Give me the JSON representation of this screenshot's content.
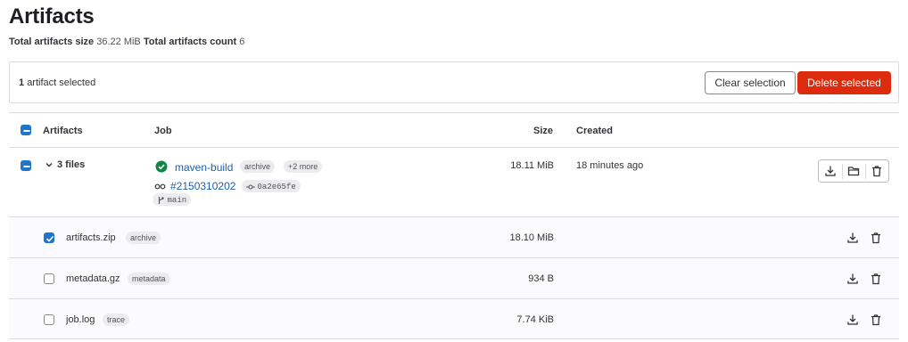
{
  "page": {
    "title": "Artifacts",
    "size_label": "Total artifacts size",
    "size_value": "36.22 MiB",
    "count_label": "Total artifacts count",
    "count_value": "6"
  },
  "selection": {
    "count": "1",
    "text": "artifact selected",
    "clear_label": "Clear selection",
    "delete_label": "Delete selected"
  },
  "table": {
    "headers": {
      "artifacts": "Artifacts",
      "job": "Job",
      "size": "Size",
      "created": "Created"
    },
    "job_row": {
      "files_label": "3 files",
      "job_name": "maven-build",
      "badge": "archive",
      "more": "+2 more",
      "pipeline": "#2150310202",
      "commit": "0a2e65fe",
      "branch": "main",
      "size": "18.11 MiB",
      "created": "18 minutes ago",
      "status": "success"
    },
    "files": [
      {
        "name": "artifacts.zip",
        "type": "archive",
        "size": "18.10 MiB",
        "checked": true
      },
      {
        "name": "metadata.gz",
        "type": "metadata",
        "size": "934 B",
        "checked": false
      },
      {
        "name": "job.log",
        "type": "trace",
        "size": "7.74 KiB",
        "checked": false
      }
    ]
  },
  "colors": {
    "accent": "#1f75cb",
    "danger": "#dd2b0e",
    "success": "#108548",
    "link": "#1f5fa7"
  },
  "icons": [
    "download-icon",
    "folder-icon",
    "trash-icon",
    "chevron-down-icon",
    "status-success-icon",
    "pipeline-icon",
    "commit-icon",
    "branch-icon",
    "checkbox-check-icon"
  ]
}
